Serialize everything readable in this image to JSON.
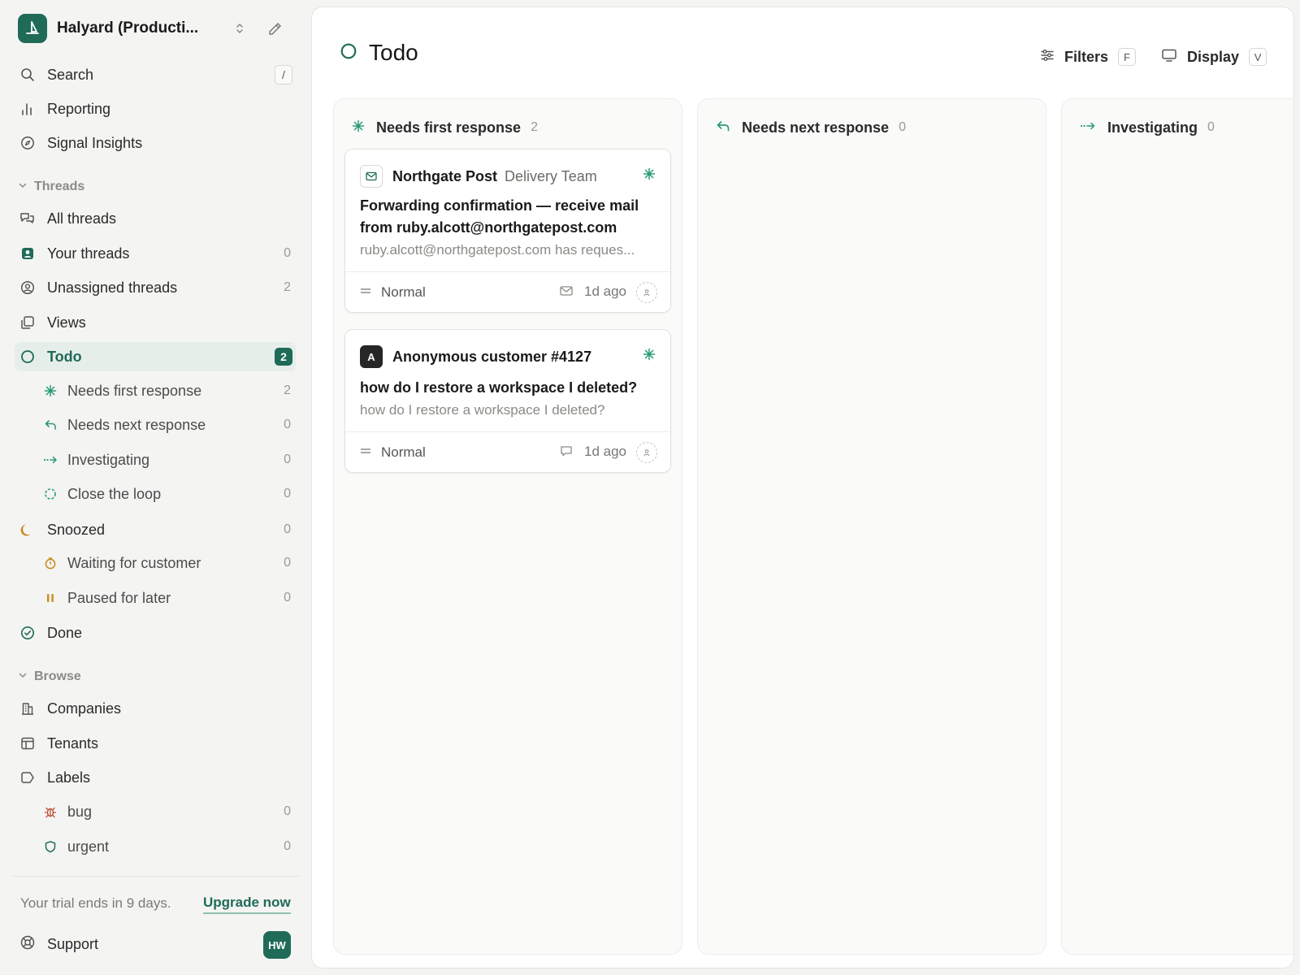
{
  "workspace": {
    "name": "Halyard (Producti..."
  },
  "nav": {
    "search": {
      "label": "Search",
      "shortcut": "/"
    },
    "reporting": {
      "label": "Reporting"
    },
    "signal_insights": {
      "label": "Signal Insights"
    }
  },
  "threads_section": {
    "title": "Threads",
    "all_threads": {
      "label": "All threads"
    },
    "your_threads": {
      "label": "Your threads",
      "count": "0"
    },
    "unassigned_threads": {
      "label": "Unassigned threads",
      "count": "2"
    },
    "views": {
      "label": "Views"
    },
    "todo": {
      "label": "Todo",
      "count": "2"
    },
    "needs_first_response": {
      "label": "Needs first response",
      "count": "2"
    },
    "needs_next_response": {
      "label": "Needs next response",
      "count": "0"
    },
    "investigating": {
      "label": "Investigating",
      "count": "0"
    },
    "close_the_loop": {
      "label": "Close the loop",
      "count": "0"
    },
    "snoozed": {
      "label": "Snoozed",
      "count": "0"
    },
    "waiting_for_customer": {
      "label": "Waiting for customer",
      "count": "0"
    },
    "paused_for_later": {
      "label": "Paused for later",
      "count": "0"
    },
    "done": {
      "label": "Done"
    }
  },
  "browse_section": {
    "title": "Browse",
    "companies": {
      "label": "Companies"
    },
    "tenants": {
      "label": "Tenants"
    },
    "labels": {
      "label": "Labels"
    },
    "bug": {
      "label": "bug",
      "count": "0"
    },
    "urgent": {
      "label": "urgent",
      "count": "0"
    }
  },
  "footer": {
    "trial_text": "Your trial ends in 9 days.",
    "upgrade_label": "Upgrade now",
    "support_label": "Support",
    "user_initials": "HW"
  },
  "main": {
    "title": "Todo",
    "filters": {
      "label": "Filters",
      "shortcut": "F"
    },
    "display": {
      "label": "Display",
      "shortcut": "V"
    },
    "columns": [
      {
        "name": "Needs first response",
        "count": "2",
        "cards": [
          {
            "sender": "Northgate Post",
            "team": "Delivery Team",
            "subject": "Forwarding confirmation — receive mail from ruby.alcott@northgatepost.com",
            "preview": "ruby.alcott@northgatepost.com has reques...",
            "priority": "Normal",
            "channel_icon": "mail-icon",
            "time": "1d ago"
          },
          {
            "avatar_letter": "A",
            "sender": "Anonymous customer #4127",
            "subject": "how do I restore a workspace I deleted?",
            "preview": "how do I restore a workspace I deleted?",
            "priority": "Normal",
            "channel_icon": "chat-icon",
            "time": "1d ago"
          }
        ]
      },
      {
        "name": "Needs next response",
        "count": "0"
      },
      {
        "name": "Investigating",
        "count": "0"
      }
    ]
  },
  "colors": {
    "brand": "#1f6b57",
    "snoozed": "#c98a1a",
    "bug": "#c0503a"
  }
}
